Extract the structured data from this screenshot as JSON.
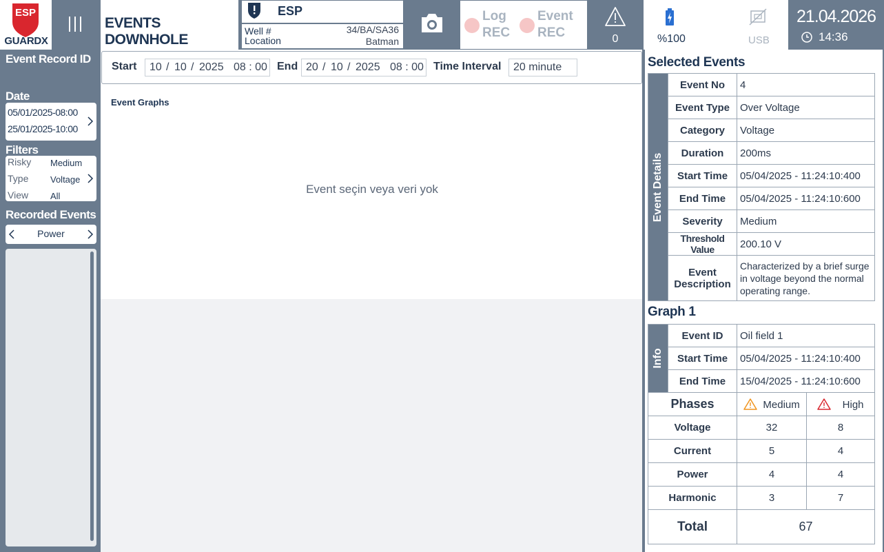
{
  "app": {
    "brand_top": "ESP",
    "brand_bottom": "GUARDX",
    "page_title": "EVENTS DOWNHOLE"
  },
  "esp": {
    "title": "ESP",
    "well_label": "Well #",
    "well_value": "34/BA/SA36",
    "location_label": "Location",
    "location_value": "Batman"
  },
  "rec": {
    "log_line1": "Log",
    "log_line2": "REC",
    "event_line1": "Event",
    "event_line2": "REC"
  },
  "alarm": {
    "count": "0"
  },
  "status": {
    "battery": "%100",
    "usb": "USB"
  },
  "clock": {
    "date": "21.04.2026",
    "time": "14:36"
  },
  "sidebar": {
    "record_id_label": "Event Record ID",
    "date_label": "Date",
    "date_from": "05/01/2025-08:00",
    "date_to": "25/01/2025-10:00",
    "filters_label": "Filters",
    "filters": [
      {
        "key": "Risky",
        "value": "Medium"
      },
      {
        "key": "Type",
        "value": "Voltage"
      },
      {
        "key": "View",
        "value": "All"
      }
    ],
    "recorded_label": "Recorded Events",
    "recorded_selector": "Power"
  },
  "filter": {
    "start_label": "Start",
    "start_day": "10",
    "start_month": "10",
    "start_year": "2025",
    "start_time": "08 : 00",
    "end_label": "End",
    "end_day": "20",
    "end_month": "10",
    "end_year": "2025",
    "end_time": "08 : 00",
    "interval_label": "Time Interval",
    "interval_value": "20 minute",
    "sep": "/"
  },
  "graph": {
    "title": "Event Graphs",
    "empty_message": "Event seçin veya veri yok"
  },
  "selected": {
    "title": "Selected Events",
    "side_label": "Event Details",
    "rows": [
      {
        "key": "Event No",
        "value": "4"
      },
      {
        "key": "Event Type",
        "value": "Over Voltage"
      },
      {
        "key": "Category",
        "value": "Voltage"
      },
      {
        "key": "Duration",
        "value": "200ms"
      },
      {
        "key": "Start Time",
        "value": "05/04/2025 - 11:24:10:400"
      },
      {
        "key": "End Time",
        "value": "05/04/2025 - 11:24:10:600"
      },
      {
        "key": "Severity",
        "value": "Medium"
      },
      {
        "key": "Threshold Value",
        "value": "200.10 V"
      },
      {
        "key": "Event Description",
        "value": "Characterized by a brief surge in voltage beyond the normal operating range."
      }
    ]
  },
  "graph1": {
    "title": "Graph 1",
    "side_label": "Info",
    "rows": [
      {
        "key": "Event ID",
        "value": "Oil field 1"
      },
      {
        "key": "Start Time",
        "value": "05/04/2025 - 11:24:10:400"
      },
      {
        "key": "End Time",
        "value": "15/04/2025 - 11:24:10:600"
      }
    ]
  },
  "phases": {
    "header": "Phases",
    "medium_label": "Medium",
    "high_label": "High",
    "medium_color": "#f0941e",
    "high_color": "#d9262e",
    "rows": [
      {
        "name": "Voltage",
        "medium": "32",
        "high": "8"
      },
      {
        "name": "Current",
        "medium": "5",
        "high": "4"
      },
      {
        "name": "Power",
        "medium": "4",
        "high": "4"
      },
      {
        "name": "Harmonic",
        "medium": "3",
        "high": "7"
      }
    ],
    "total_label": "Total",
    "total_value": "67"
  },
  "colors": {
    "panel": "#6a7b8e",
    "navy": "#1e3553",
    "brand_red": "#d9262e",
    "rec_dot": "#f6c6c6"
  }
}
